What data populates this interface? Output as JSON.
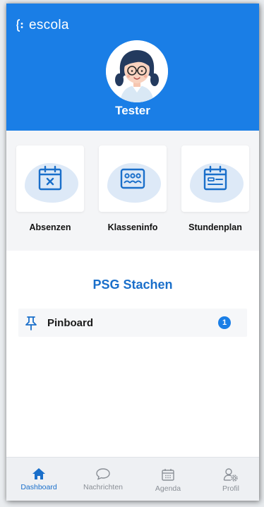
{
  "app": {
    "brand": "escola",
    "accent": "#1a7ee6"
  },
  "profile": {
    "name": "Tester"
  },
  "tiles": [
    {
      "label": "Absenzen",
      "icon": "calendar-x-icon"
    },
    {
      "label": "Klasseninfo",
      "icon": "class-group-icon"
    },
    {
      "label": "Stundenplan",
      "icon": "schedule-icon"
    }
  ],
  "school": {
    "name": "PSG Stachen"
  },
  "pinboard": {
    "label": "Pinboard",
    "count": "1",
    "icon": "pin-icon"
  },
  "nav": [
    {
      "label": "Dashboard",
      "icon": "home-icon",
      "active": true
    },
    {
      "label": "Nachrichten",
      "icon": "chat-icon",
      "active": false
    },
    {
      "label": "Agenda",
      "icon": "calendar-icon",
      "active": false
    },
    {
      "label": "Profil",
      "icon": "profile-settings-icon",
      "active": false
    }
  ]
}
